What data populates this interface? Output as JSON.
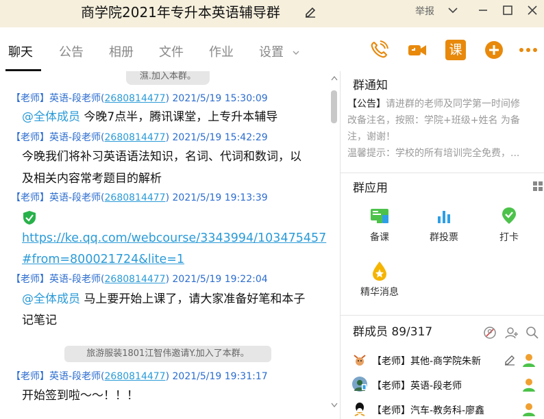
{
  "window": {
    "title": "商学院2021年专升本英语辅导群",
    "report": "举报"
  },
  "tabs": [
    {
      "label": "聊天"
    },
    {
      "label": "公告"
    },
    {
      "label": "相册"
    },
    {
      "label": "文件"
    },
    {
      "label": "作业"
    },
    {
      "label": "设置"
    }
  ],
  "toolbar": {
    "course_label": "课"
  },
  "chat": {
    "top_system_note": "濕.加入本群。",
    "messages": [
      {
        "role": "【老师】",
        "name": "英语-段老师(",
        "qq": "2680814477",
        "tail": ")",
        "time": "2021/5/19 15:30:09",
        "mention": "@全体成员",
        "text": " 今晚7点半，腾讯课堂，上专升本辅导"
      },
      {
        "role": "【老师】",
        "name": "英语-段老师(",
        "qq": "2680814477",
        "tail": ")",
        "time": "2021/5/19 15:42:29",
        "text_line1": "今晚我们将补习英语语法知识，名词、代词和数词，以",
        "text_line2": "及相关内容常考题目的解析"
      },
      {
        "role": "【老师】",
        "name": "英语-段老师(",
        "qq": "2680814477",
        "tail": ")",
        "time": "2021/5/19 19:13:39",
        "link_line1": "https://ke.qq.com/webcourse/3343994/103475457",
        "link_line2": "#from=800021724&lite=1"
      },
      {
        "role": "【老师】",
        "name": "英语-段老师(",
        "qq": "2680814477",
        "tail": ")",
        "time": "2021/5/19 19:22:04",
        "mention": "@全体成员",
        "text_line1": " 马上要开始上课了，请大家准备好笔和本子",
        "text_line2": "记笔记"
      },
      {
        "role": "【老师】",
        "name": "英语-段老师(",
        "qq": "2680814477",
        "tail": ")",
        "time": "2021/5/19 19:31:17",
        "text": "开始签到啦～～！！！"
      }
    ],
    "system_note": "旅游服装1801江智伟邀请Y.加入了本群。"
  },
  "notice": {
    "title": "群通知",
    "tag": "【公告】",
    "line1": "请进群的老师及同学第一时间修",
    "line2": "改备注名，按照：学院+班级+姓名 为备",
    "line3": "注，谢谢！",
    "line4": "温馨提示：学校的所有培训完全免费，..."
  },
  "apps": {
    "title": "群应用",
    "items": [
      {
        "label": "备课",
        "icon": "lesson-prep-icon"
      },
      {
        "label": "群投票",
        "icon": "vote-icon"
      },
      {
        "label": "打卡",
        "icon": "checkin-icon"
      },
      {
        "label": "精华消息",
        "icon": "essence-icon"
      }
    ]
  },
  "members": {
    "title": "群成员 89/317",
    "list": [
      {
        "name": "【老师】其他-商学院朱新"
      },
      {
        "name": "【老师】英语-段老师"
      },
      {
        "name": "【老师】汽车-教务科-廖鑫"
      }
    ]
  },
  "colors": {
    "accent_orange": "#e8890c",
    "link_blue": "#2b9bd8",
    "meta_blue": "#2b6ccf",
    "title_bg": "#f5efdc"
  }
}
